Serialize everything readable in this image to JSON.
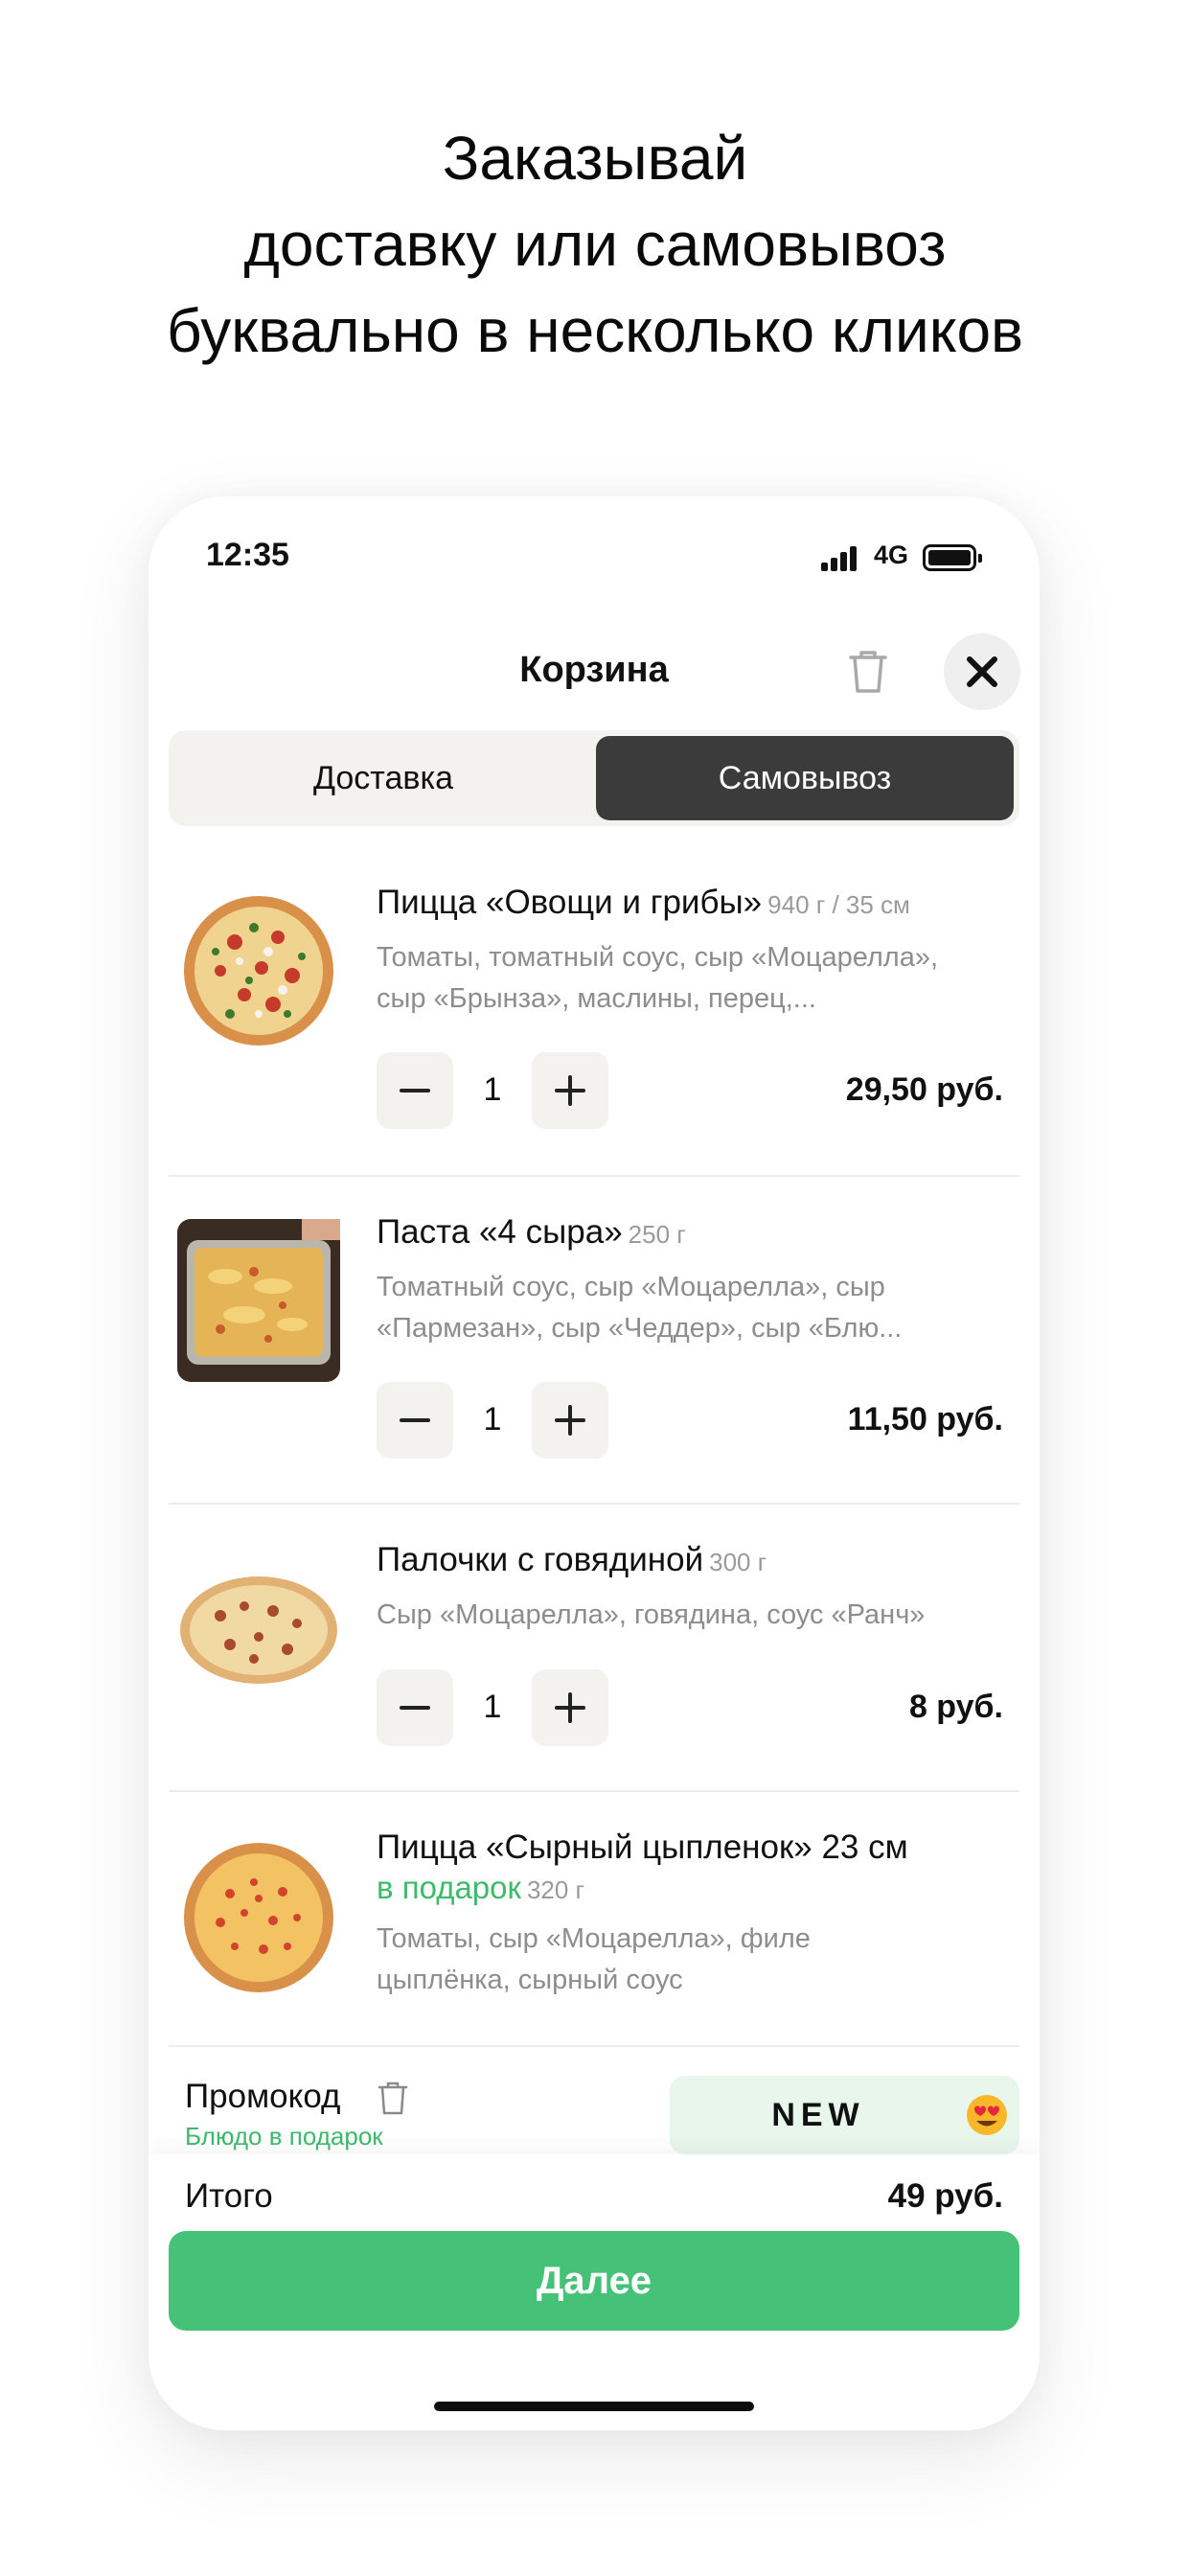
{
  "headline": {
    "line1": "Заказывай",
    "line2": "доставку или самовывоз",
    "line3": "буквально в несколько кликов"
  },
  "status_bar": {
    "time": "12:35",
    "network": "4G"
  },
  "header": {
    "title": "Корзина",
    "trash_icon": "trash-icon",
    "close_icon": "close-icon"
  },
  "delivery_mode": {
    "options": [
      "Доставка",
      "Самовывоз"
    ],
    "selected": "Самовывоз"
  },
  "items": [
    {
      "name": "Пицца «Овощи и грибы»",
      "weight": "940 г / 35 см",
      "desc_line1": "Томаты, томатный соус, сыр «Моцарелла»,",
      "desc_line2": "сыр «Брынза», маслины, перец,...",
      "quantity": "1",
      "price": "29,50 руб."
    },
    {
      "name": "Паста «4 сыра»",
      "weight": "250 г",
      "desc_line1": "Томатный соус, сыр «Моцарелла», сыр",
      "desc_line2": "«Пармезан», сыр «Чеддер», сыр «Блю...",
      "quantity": "1",
      "price": "11,50 руб."
    },
    {
      "name": "Палочки с говядиной",
      "weight": "300 г",
      "desc_line1": "Сыр «Моцарелла», говядина, соус «Ранч»",
      "quantity": "1",
      "price": "8 руб."
    },
    {
      "name": "Пицца «Сырный цыпленок» 23 см",
      "gift": "в подарок",
      "weight": "320 г",
      "desc_line1": "Томаты, сыр «Моцарелла», филе",
      "desc_line2": "цыплёнка, сырный соус"
    }
  ],
  "promo": {
    "label": "Промокод",
    "subtitle": "Блюдо в подарок",
    "code": "NEW",
    "emoji_icon": "heart-eyes-emoji-icon"
  },
  "footer": {
    "total_label": "Итого",
    "total_value": "49 руб.",
    "next_label": "Далее"
  },
  "colors": {
    "accent": "#45C278",
    "segment_active": "#3B3B3B",
    "promo_bg": "#E8F6EC"
  }
}
